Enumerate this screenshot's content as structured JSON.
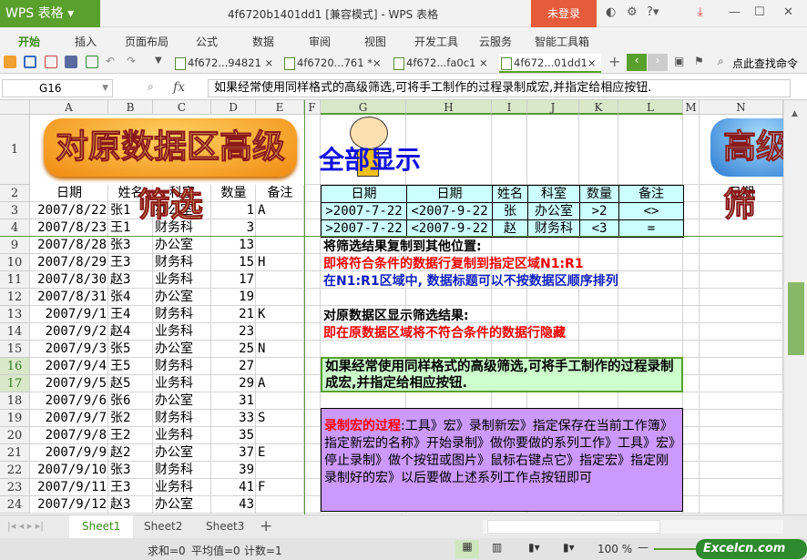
{
  "app": {
    "name": "WPS 表格",
    "title": "4f6720b1401dd1 [兼容模式] - WPS 表格",
    "login": "未登录"
  },
  "menu": [
    "开始",
    "插入",
    "页面布局",
    "公式",
    "数据",
    "审阅",
    "视图",
    "开发工具",
    "云服务",
    "智能工具箱"
  ],
  "doc_tabs": [
    "4f672...94821",
    "4f6720...761 *",
    "4f672...fa0c1",
    "4f672...01dd1"
  ],
  "search_cmd": "点此查找命令",
  "formula_bar": {
    "cell": "G16",
    "fx": "fx",
    "content": "如果经常使用同样格式的高级筛选,可将手工制作的过程录制成宏,并指定给相应按钮."
  },
  "columns": [
    "A",
    "B",
    "C",
    "D",
    "E",
    "F",
    "G",
    "H",
    "I",
    "J",
    "K",
    "L",
    "M",
    "N"
  ],
  "banners": {
    "left": "对原数据区高级筛选",
    "middle": "全部显示",
    "right": "高级筛"
  },
  "table": {
    "headers": [
      "日期",
      "姓名",
      "科室",
      "数量",
      "备注"
    ],
    "rows": [
      [
        "3",
        "2007/8/22",
        "张1",
        "办公室",
        "1",
        "A"
      ],
      [
        "4",
        "2007/8/23",
        "王1",
        "财务科",
        "3",
        ""
      ],
      [
        "9",
        "2007/8/28",
        "张3",
        "办公室",
        "13",
        ""
      ],
      [
        "10",
        "2007/8/29",
        "王3",
        "财务科",
        "15",
        "H"
      ],
      [
        "11",
        "2007/8/30",
        "赵3",
        "业务科",
        "17",
        ""
      ],
      [
        "12",
        "2007/8/31",
        "张4",
        "办公室",
        "19",
        ""
      ],
      [
        "13",
        "2007/9/1",
        "王4",
        "财务科",
        "21",
        "K"
      ],
      [
        "14",
        "2007/9/2",
        "赵4",
        "业务科",
        "23",
        ""
      ],
      [
        "15",
        "2007/9/3",
        "张5",
        "办公室",
        "25",
        "N"
      ],
      [
        "16",
        "2007/9/4",
        "王5",
        "财务科",
        "27",
        ""
      ],
      [
        "17",
        "2007/9/5",
        "赵5",
        "业务科",
        "29",
        "A"
      ],
      [
        "18",
        "2007/9/6",
        "张6",
        "办公室",
        "31",
        ""
      ],
      [
        "19",
        "2007/9/7",
        "张2",
        "财务科",
        "33",
        "S"
      ],
      [
        "20",
        "2007/9/8",
        "王2",
        "业务科",
        "35",
        ""
      ],
      [
        "21",
        "2007/9/9",
        "赵2",
        "办公室",
        "37",
        "E"
      ],
      [
        "22",
        "2007/9/10",
        "张3",
        "财务科",
        "39",
        ""
      ],
      [
        "23",
        "2007/9/11",
        "王3",
        "业务科",
        "41",
        "F"
      ],
      [
        "24",
        "2007/9/12",
        "赵3",
        "办公室",
        "43",
        ""
      ]
    ]
  },
  "criteria": {
    "headers": [
      "日期",
      "日期",
      "姓名",
      "科室",
      "数量",
      "备注"
    ],
    "rows": [
      [
        ">2007-7-22",
        "<2007-9-22",
        "张",
        "办公室",
        ">2",
        "<>"
      ],
      [
        ">2007-7-22",
        "<2007-9-22",
        "赵",
        "财务科",
        "<3",
        "="
      ]
    ]
  },
  "n2": "日期",
  "notes": {
    "copy_title": "将筛选结果复制到其他位置:",
    "copy_red": "即将符合条件的数据行复制到指定区域N1:R1",
    "copy_blue": "在N1:R1区域中, 数据标题可以不按数据区顺序排列",
    "orig_title": "对原数据区显示筛选结果:",
    "orig_red": "即在原数据区域将不符合条件的数据行隐藏",
    "macro_tip": "如果经常使用同样格式的高级筛选,可将手工制作的过程录制成宏,并指定给相应按钮.",
    "macro_label": "录制宏的过程",
    "macro_body": ":工具》宏》录制新宏》指定保存在当前工作簿》指定新宏的名称》开始录制》做你要做的系列工作》工具》宏》停止录制》做个按钮或图片》鼠标右键点它》指定宏》指定刚录制好的宏》以后要做上述系列工作点按钮即可"
  },
  "sheets": [
    "Sheet1",
    "Sheet2",
    "Sheet3"
  ],
  "status": {
    "sum": "求和=0",
    "avg": "平均值=0",
    "count": "计数=1",
    "zoom": "100 %"
  },
  "watermark": "Excelcn.com",
  "colors": {
    "green": "#5aa02c",
    "crit_bg": "#ccffff",
    "tip_bg": "#ccffcc",
    "macro_bg": "#cc99ff"
  }
}
